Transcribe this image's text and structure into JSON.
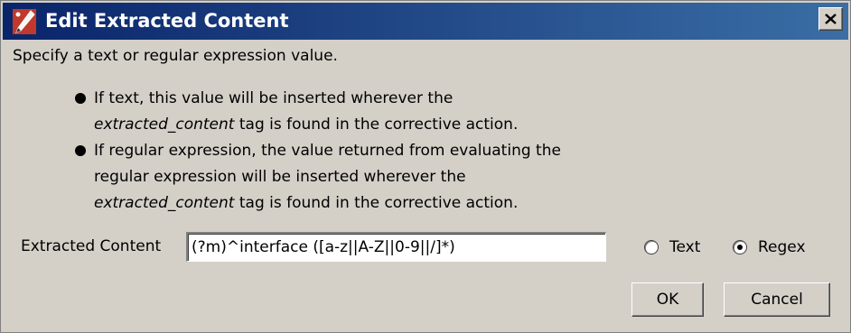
{
  "window": {
    "title": "Edit Extracted Content",
    "app_icon": "pencil-icon",
    "close_icon": "close-icon",
    "title_gradient": [
      "#0a246a",
      "#3a6ea5"
    ]
  },
  "instruction": "Specify a text or regular expression value.",
  "bullets": [
    {
      "lines": [
        {
          "before": "If text, this value will be inserted wherever the",
          "tag": "",
          "after": ""
        },
        {
          "before": "",
          "tag": "extracted_content",
          "after": " tag is found in the corrective action."
        }
      ]
    },
    {
      "lines": [
        {
          "before": "If regular expression, the value returned from evaluating the",
          "tag": "",
          "after": ""
        },
        {
          "before": "regular expression will be inserted wherever the",
          "tag": "",
          "after": ""
        },
        {
          "before": "",
          "tag": "extracted_content",
          "after": " tag is found in the corrective action."
        }
      ]
    }
  ],
  "field": {
    "label": "Extracted Content",
    "value": "(?m)^interface ([a-z||A-Z||0-9||/]*)"
  },
  "radios": [
    {
      "label": "Text",
      "selected": false
    },
    {
      "label": "Regex",
      "selected": true
    }
  ],
  "buttons": {
    "ok": "OK",
    "cancel": "Cancel"
  }
}
